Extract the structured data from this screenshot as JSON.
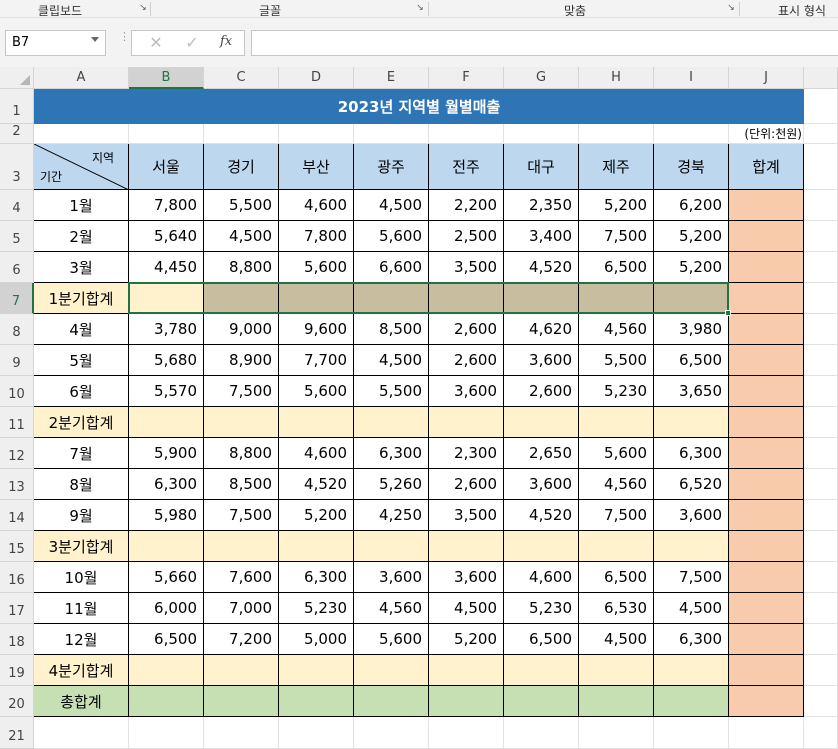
{
  "ribbon": {
    "groups": [
      {
        "label": "클립보드"
      },
      {
        "label": "글꼴"
      },
      {
        "label": "맞춤"
      },
      {
        "label": "표시 형식"
      }
    ]
  },
  "name_box": {
    "value": "B7"
  },
  "formula_bar": {
    "fx_label": "fx",
    "value": ""
  },
  "columns": [
    "A",
    "B",
    "C",
    "D",
    "E",
    "F",
    "G",
    "H",
    "I",
    "J"
  ],
  "rows": [
    "1",
    "2",
    "3",
    "4",
    "5",
    "6",
    "7",
    "8",
    "9",
    "10",
    "11",
    "12",
    "13",
    "14",
    "15",
    "16",
    "17",
    "18",
    "19",
    "20",
    "21"
  ],
  "colors": {
    "title_bg": "#2e75b6",
    "header_bg": "#bdd7ee",
    "subtotal_bg": "#fff2cc",
    "selected_range_bg": "#c8bd9e",
    "total_col_bg": "#f8cbad",
    "grand_total_bg": "#c6e0b4",
    "selection": "#217346"
  },
  "sheet": {
    "title": "2023년 지역별 월별매출",
    "unit_note": "(단위:천원)",
    "corner_top": "지역",
    "corner_bottom": "기간",
    "regions": [
      "서울",
      "경기",
      "부산",
      "광주",
      "전주",
      "대구",
      "제주",
      "경북"
    ],
    "total_header": "합계",
    "grand_total_label": "총합계",
    "rows": [
      {
        "label": "1월",
        "values": [
          "7,800",
          "5,500",
          "4,600",
          "4,500",
          "2,200",
          "2,350",
          "5,200",
          "6,200"
        ]
      },
      {
        "label": "2월",
        "values": [
          "5,640",
          "4,500",
          "7,800",
          "5,600",
          "2,500",
          "3,400",
          "7,500",
          "5,200"
        ]
      },
      {
        "label": "3월",
        "values": [
          "4,450",
          "8,800",
          "5,600",
          "6,600",
          "3,500",
          "4,520",
          "6,500",
          "5,200"
        ]
      },
      {
        "label": "1분기합계",
        "subtotal": true
      },
      {
        "label": "4월",
        "values": [
          "3,780",
          "9,000",
          "9,600",
          "8,500",
          "2,600",
          "4,620",
          "4,560",
          "3,980"
        ]
      },
      {
        "label": "5월",
        "values": [
          "5,680",
          "8,900",
          "7,700",
          "4,500",
          "2,600",
          "3,600",
          "5,500",
          "6,500"
        ]
      },
      {
        "label": "6월",
        "values": [
          "5,570",
          "7,500",
          "5,600",
          "5,500",
          "3,600",
          "2,600",
          "5,230",
          "3,650"
        ]
      },
      {
        "label": "2분기합계",
        "subtotal": true
      },
      {
        "label": "7월",
        "values": [
          "5,900",
          "8,800",
          "4,600",
          "6,300",
          "2,300",
          "2,650",
          "5,600",
          "6,300"
        ]
      },
      {
        "label": "8월",
        "values": [
          "6,300",
          "8,500",
          "4,520",
          "5,260",
          "2,600",
          "3,600",
          "4,560",
          "6,520"
        ]
      },
      {
        "label": "9월",
        "values": [
          "5,980",
          "7,500",
          "5,200",
          "4,250",
          "3,500",
          "4,520",
          "7,500",
          "3,600"
        ]
      },
      {
        "label": "3분기합계",
        "subtotal": true
      },
      {
        "label": "10월",
        "values": [
          "5,660",
          "7,600",
          "6,300",
          "3,600",
          "3,600",
          "4,600",
          "6,500",
          "7,500"
        ]
      },
      {
        "label": "11월",
        "values": [
          "6,000",
          "7,000",
          "5,230",
          "4,560",
          "4,500",
          "5,230",
          "6,530",
          "4,500"
        ]
      },
      {
        "label": "12월",
        "values": [
          "6,500",
          "7,200",
          "5,000",
          "5,600",
          "5,200",
          "6,500",
          "4,500",
          "6,300"
        ]
      },
      {
        "label": "4분기합계",
        "subtotal": true
      }
    ]
  }
}
